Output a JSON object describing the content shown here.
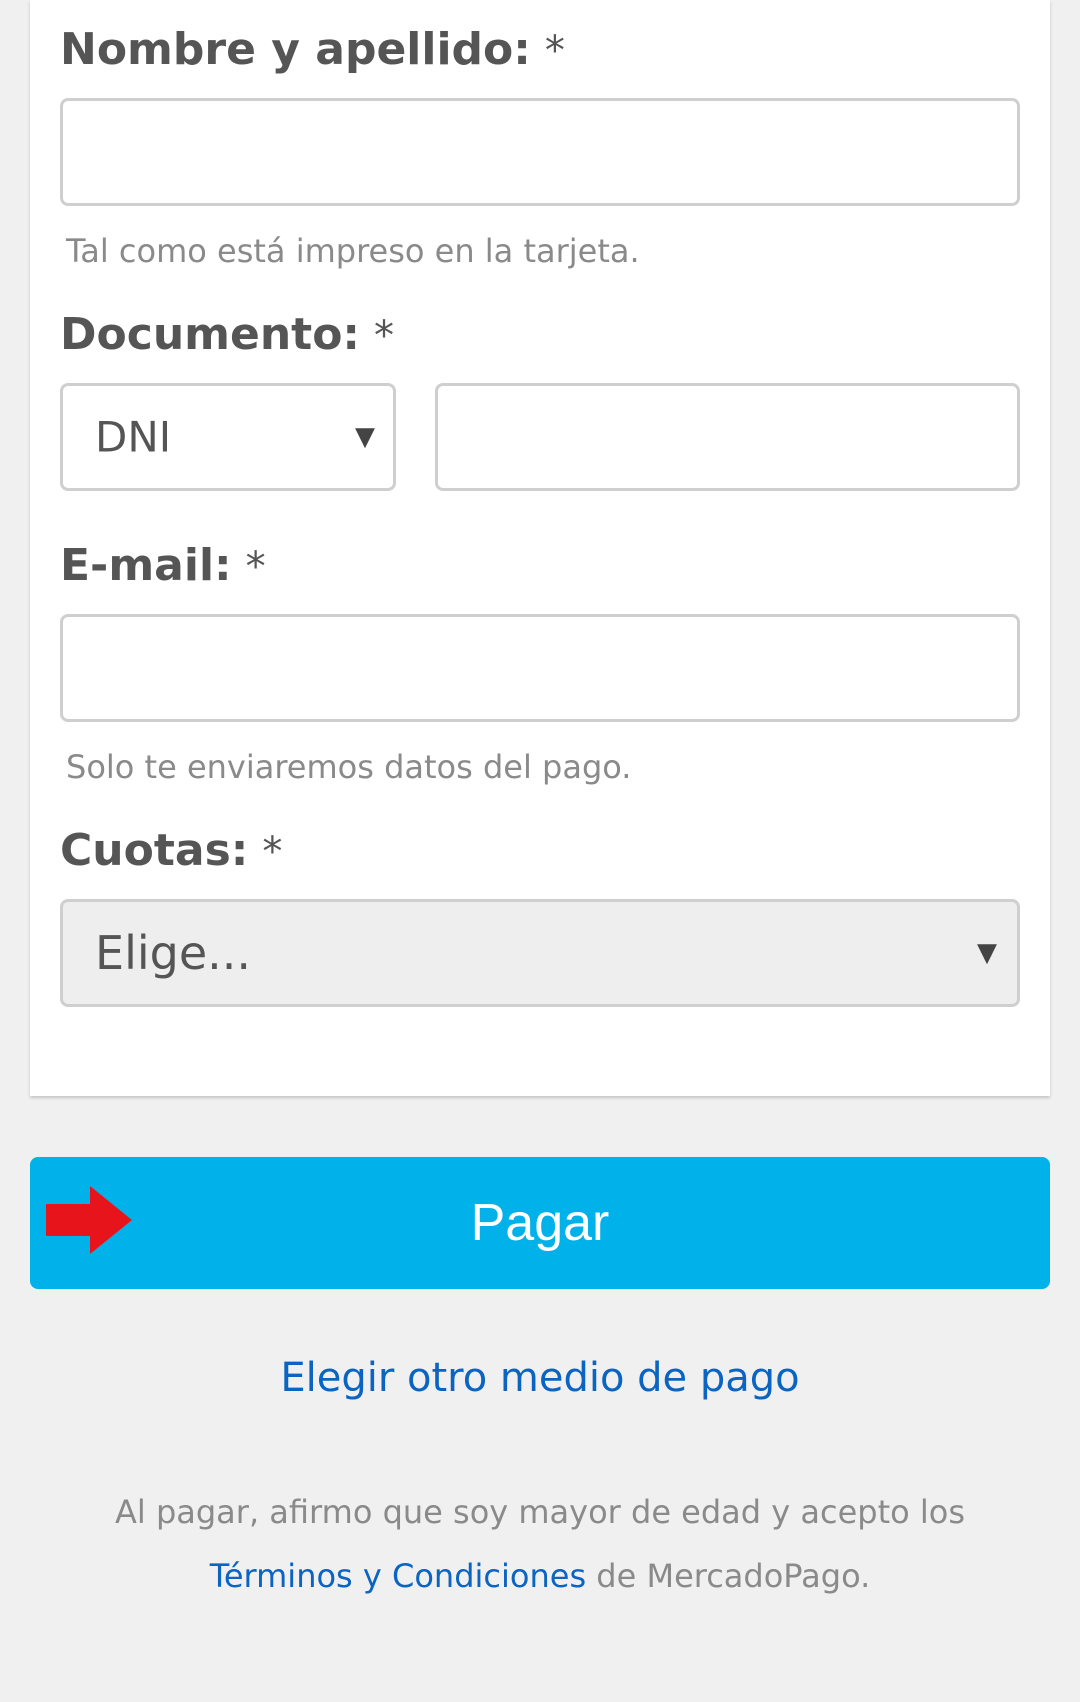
{
  "form": {
    "name": {
      "label": "Nombre y apellido:",
      "required_mark": "*",
      "value": "",
      "hint": "Tal como está impreso en la tarjeta."
    },
    "document": {
      "label": "Documento:",
      "required_mark": "*",
      "type_selected": "DNI",
      "number_value": ""
    },
    "email": {
      "label": "E-mail:",
      "required_mark": "*",
      "value": "",
      "hint": "Solo te enviaremos datos del pago."
    },
    "installments": {
      "label": "Cuotas:",
      "required_mark": "*",
      "selected": "Elige..."
    }
  },
  "pay_button": {
    "label": "Pagar",
    "color": "#00b1ea"
  },
  "arrow_icon": {
    "icon": "right-arrow-icon",
    "color": "#e8141c"
  },
  "other_payment_link": "Elegir otro medio de pago",
  "terms": {
    "prefix": "Al pagar, afirmo que soy mayor de edad y acepto los ",
    "link": "Términos y Condiciones",
    "suffix": " de MercadoPago."
  },
  "colors": {
    "link": "#0b64c1",
    "background": "#f0f0f0"
  }
}
